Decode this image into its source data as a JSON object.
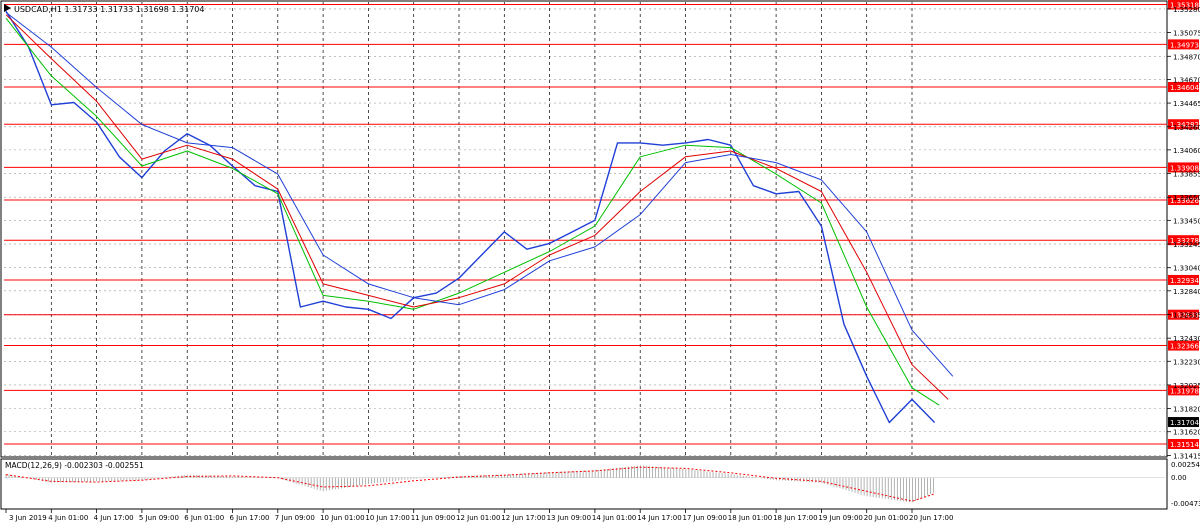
{
  "header": {
    "title": "USDCAD,H1  1.31733 1.31733 1.31698 1.31704"
  },
  "macd_panel": {
    "label": "MACD(12,26,9) -0.002303 -0.002551",
    "scale": [
      "0.002541",
      "0.00",
      "-0.004731"
    ]
  },
  "colors": {
    "background": "#ffffff",
    "price": "#1f3fd6",
    "ma_fast": "#00c000",
    "ma_mid": "#e00000",
    "ma_slow": "#1f3fd6",
    "level_line": "#ff0000",
    "level_badge": "#ff0000",
    "current_badge": "#000000",
    "grid": "#9a9a9a",
    "macd_hist": "#a0a0a0",
    "macd_signal": "#ff0000"
  },
  "chart_data": {
    "type": "line",
    "symbol": "USDCAD",
    "timeframe": "H1",
    "ohlc_last": {
      "open": 1.31733,
      "high": 1.31733,
      "low": 1.31698,
      "close": 1.31704
    },
    "ylim": [
      1.3141,
      1.3534
    ],
    "y_ticks": [
      "1.35280",
      "1.35075",
      "1.34870",
      "1.34670",
      "1.34465",
      "1.34260",
      "1.34060",
      "1.33855",
      "1.33650",
      "1.33450",
      "1.33245",
      "1.33040",
      "1.32840",
      "1.32635",
      "1.32430",
      "1.32230",
      "1.32025",
      "1.31820",
      "1.31620",
      "1.31415"
    ],
    "x_ticks": [
      "3 Jun 2019",
      "4 Jun 01:00",
      "4 Jun 17:00",
      "5 Jun 09:00",
      "6 Jun 01:00",
      "6 Jun 17:00",
      "7 Jun 09:00",
      "10 Jun 01:00",
      "10 Jun 17:00",
      "11 Jun 09:00",
      "12 Jun 01:00",
      "12 Jun 17:00",
      "13 Jun 09:00",
      "14 Jun 01:00",
      "14 Jun 17:00",
      "17 Jun 09:00",
      "18 Jun 01:00",
      "18 Jun 17:00",
      "19 Jun 09:00",
      "20 Jun 01:00",
      "20 Jun 17:00"
    ],
    "levels": [
      "1.35318",
      "1.34973",
      "1.34604",
      "1.34282",
      "1.33908",
      "1.33626",
      "1.33278",
      "1.32934",
      "1.32633",
      "1.32366",
      "1.31978",
      "1.31514"
    ],
    "current_price": "1.31704",
    "series": [
      {
        "name": "price",
        "x": [
          0,
          0.5,
          1,
          1.5,
          2,
          2.5,
          3,
          3.5,
          4,
          4.5,
          5,
          5.5,
          6,
          6.5,
          7,
          7.5,
          8,
          8.5,
          9,
          9.5,
          10,
          10.5,
          11,
          11.5,
          12,
          12.5,
          13,
          13.5,
          14,
          14.5,
          15,
          15.5,
          16,
          16.5,
          17,
          17.5,
          18,
          18.5,
          19,
          19.5,
          20,
          20.5
        ],
        "values": [
          1.3526,
          1.3495,
          1.3445,
          1.3447,
          1.343,
          1.34,
          1.3382,
          1.3405,
          1.342,
          1.341,
          1.3392,
          1.3375,
          1.337,
          1.327,
          1.3275,
          1.327,
          1.3268,
          1.326,
          1.3278,
          1.3282,
          1.3295,
          1.3315,
          1.3335,
          1.332,
          1.3325,
          1.3335,
          1.3345,
          1.3412,
          1.3412,
          1.341,
          1.3412,
          1.3415,
          1.341,
          1.3375,
          1.3368,
          1.337,
          1.334,
          1.3255,
          1.321,
          1.317,
          1.319,
          1.317
        ]
      },
      {
        "name": "ma_fast",
        "x": [
          0,
          1,
          2,
          3,
          4,
          5,
          6,
          7,
          8,
          9,
          10,
          11,
          12,
          13,
          14,
          15,
          16,
          17,
          18,
          19,
          20,
          20.6
        ],
        "values": [
          1.352,
          1.347,
          1.3435,
          1.3392,
          1.3405,
          1.339,
          1.3368,
          1.328,
          1.3275,
          1.3268,
          1.3282,
          1.33,
          1.3318,
          1.334,
          1.34,
          1.341,
          1.3408,
          1.3385,
          1.336,
          1.327,
          1.32,
          1.3185
        ]
      },
      {
        "name": "ma_mid",
        "x": [
          0,
          1,
          2,
          3,
          4,
          5,
          6,
          7,
          8,
          9,
          10,
          11,
          12,
          13,
          14,
          15,
          16,
          17,
          18,
          19,
          20,
          20.8
        ],
        "values": [
          1.3523,
          1.3485,
          1.3448,
          1.3398,
          1.341,
          1.3398,
          1.3372,
          1.329,
          1.328,
          1.327,
          1.3278,
          1.329,
          1.3315,
          1.3332,
          1.337,
          1.34,
          1.3405,
          1.339,
          1.337,
          1.33,
          1.322,
          1.319
        ]
      },
      {
        "name": "ma_slow",
        "x": [
          0,
          1,
          2,
          3,
          4,
          5,
          6,
          7,
          8,
          9,
          10,
          11,
          12,
          13,
          14,
          15,
          16,
          17,
          18,
          19,
          20,
          20.9
        ],
        "values": [
          1.3525,
          1.3495,
          1.346,
          1.3428,
          1.3412,
          1.3408,
          1.3385,
          1.3315,
          1.329,
          1.3278,
          1.3272,
          1.3285,
          1.331,
          1.3322,
          1.335,
          1.3395,
          1.3402,
          1.3395,
          1.338,
          1.3335,
          1.325,
          1.321
        ]
      }
    ],
    "macd": {
      "x": [
        0,
        1,
        2,
        3,
        4,
        5,
        6,
        7,
        8,
        9,
        10,
        11,
        12,
        13,
        14,
        15,
        16,
        17,
        18,
        19,
        20,
        20.5
      ],
      "histogram": [
        0.0006,
        -0.0008,
        -0.0006,
        -0.0004,
        0.0005,
        0.0002,
        -0.0001,
        -0.0022,
        -0.001,
        -0.0002,
        0.0003,
        0.0005,
        0.0009,
        0.0012,
        0.002,
        0.0014,
        0.0006,
        -0.0004,
        -0.0008,
        -0.003,
        -0.004,
        -0.0023
      ],
      "signal": [
        0.0005,
        -0.0006,
        -0.0007,
        -0.0004,
        0.0002,
        0.0003,
        0.0,
        -0.0015,
        -0.0013,
        -0.0005,
        0.0001,
        0.0004,
        0.0008,
        0.0011,
        0.0017,
        0.0015,
        0.0008,
        -0.0001,
        -0.0006,
        -0.0022,
        -0.0038,
        -0.0026
      ],
      "ylim": [
        -0.004731,
        0.002541
      ]
    }
  }
}
